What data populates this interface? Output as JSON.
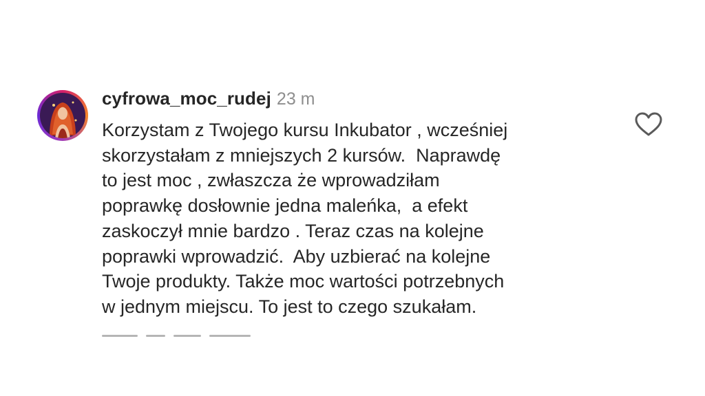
{
  "comment": {
    "username": "cyfrowa_moc_rudej",
    "time": "23 m",
    "lines": [
      "Korzystam z Twojego kursu Inkubator , wcześniej",
      "skorzystałam z mniejszych 2 kursów.  Naprawdę",
      "to jest moc , zwłaszcza że wprowadziłam",
      "poprawkę dosłownie jedna maleńka,  a efekt",
      "zaskoczył mnie bardzo . Teraz czas na kolejne",
      "poprawki wprowadzić.  Aby uzbierać na kolejne",
      "Twoje produkty. Także moc wartości potrzebnych",
      "w jednym miejscu. To jest to czego szukałam."
    ],
    "like_icon": "heart-outline-icon",
    "avatar_icon": "profile-avatar"
  },
  "colors": {
    "text": "#262626",
    "secondary": "#8e8e8e",
    "background": "#ffffff"
  }
}
